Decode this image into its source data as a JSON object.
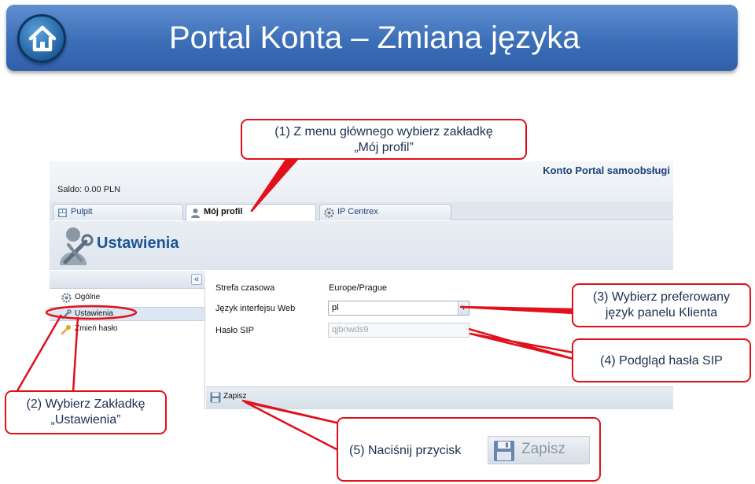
{
  "slide": {
    "title": "Portal Konta – Zmiana języka"
  },
  "app": {
    "portal_title": "Konto Portal samoobsługi",
    "balance": "Saldo: 0.00 PLN",
    "tabs": [
      {
        "label": "Pulpit",
        "icon": "dashboard-icon"
      },
      {
        "label": "Mój profil",
        "icon": "user-icon"
      },
      {
        "label": "IP Centrex",
        "icon": "gear-icon"
      }
    ],
    "section_title": "Ustawienia",
    "collapse_label": "«",
    "sidebar": [
      {
        "label": "Ogólne",
        "icon": "gear-icon"
      },
      {
        "label": "Ustawienia",
        "icon": "wrench-icon"
      },
      {
        "label": "Zmień hasło",
        "icon": "key-icon"
      }
    ],
    "form": {
      "timezone_label": "Strefa czasowa",
      "timezone_value": "Europe/Prague",
      "language_label": "Język interfejsu Web",
      "language_value": "pl",
      "sip_password_label": "Hasło SIP",
      "sip_password_value": "qjbnwds9"
    },
    "save_label": "Zapisz"
  },
  "callouts": {
    "step1": [
      "(1) Z menu głównego wybierz zakładkę",
      "„Mój profil”"
    ],
    "step2": [
      "(2) Wybierz Zakładkę",
      "„Ustawienia”"
    ],
    "step3": [
      "(3) Wybierz preferowany",
      "język panelu Klienta"
    ],
    "step4": "(4) Podgląd hasła SIP",
    "step5": "(5) Naciśnij przycisk",
    "step5_button_label": "Zapisz"
  },
  "colors": {
    "header": "#3d6fb8",
    "callout_border": "#e1101a",
    "accent_text": "#1d5596"
  }
}
